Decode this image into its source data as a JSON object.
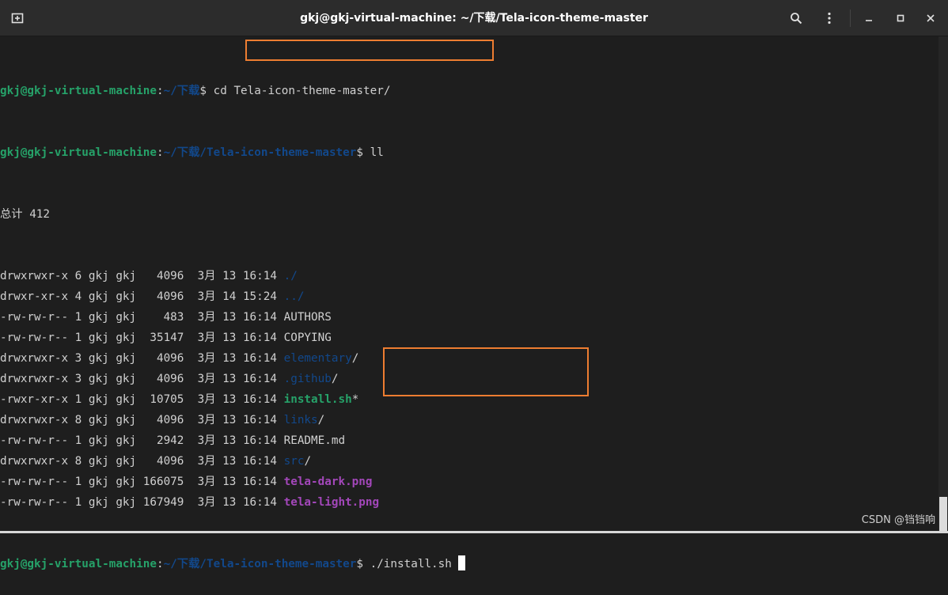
{
  "window": {
    "title": "gkj@gkj-virtual-machine: ~/下载/Tela-icon-theme-master",
    "icons": {
      "new_tab": "new-tab-icon",
      "search": "search-icon",
      "menu": "kebab-menu-icon",
      "minimize": "minimize-icon",
      "maximize": "maximize-icon",
      "close": "close-icon"
    }
  },
  "prompt": {
    "userhost": "gkj@gkj-virtual-machine",
    "colon": ":",
    "path1": "~/下载",
    "path2": "~/下载/Tela-icon-theme-master",
    "dollar": "$ "
  },
  "commands": {
    "cmd1_prefix": "cd ",
    "cmd1_arg": "Tela-icon-theme-master/",
    "cmd2": "ll",
    "cmd3": "./install.sh"
  },
  "total": "总计 412",
  "listing": [
    {
      "meta": "drwxrwxr-x 6 gkj gkj   4096  3月 13 16:14 ",
      "name": "./",
      "style": "bd"
    },
    {
      "meta": "drwxr-xr-x 4 gkj gkj   4096  3月 14 15:24 ",
      "name": "../",
      "style": "bd"
    },
    {
      "meta": "-rw-rw-r-- 1 gkj gkj    483  3月 13 16:14 ",
      "name": "AUTHORS",
      "style": "w"
    },
    {
      "meta": "-rw-rw-r-- 1 gkj gkj  35147  3月 13 16:14 ",
      "name": "COPYING",
      "style": "w"
    },
    {
      "meta": "drwxrwxr-x 3 gkj gkj   4096  3月 13 16:14 ",
      "name": "elementary",
      "suffix": "/",
      "style": "bd"
    },
    {
      "meta": "drwxrwxr-x 3 gkj gkj   4096  3月 13 16:14 ",
      "name": ".github",
      "suffix": "/",
      "style": "bd"
    },
    {
      "meta": "-rwxr-xr-x 1 gkj gkj  10705  3月 13 16:14 ",
      "name": "install.sh",
      "suffix": "*",
      "style": "gx"
    },
    {
      "meta": "drwxrwxr-x 8 gkj gkj   4096  3月 13 16:14 ",
      "name": "links",
      "suffix": "/",
      "style": "bd"
    },
    {
      "meta": "-rw-rw-r-- 1 gkj gkj   2942  3月 13 16:14 ",
      "name": "README.md",
      "style": "w"
    },
    {
      "meta": "drwxrwxr-x 8 gkj gkj   4096  3月 13 16:14 ",
      "name": "src",
      "suffix": "/",
      "style": "bd"
    },
    {
      "meta": "-rw-rw-r-- 1 gkj gkj 166075  3月 13 16:14 ",
      "name": "tela-dark.png",
      "style": "m"
    },
    {
      "meta": "-rw-rw-r-- 1 gkj gkj 167949  3月 13 16:14 ",
      "name": "tela-light.png",
      "style": "m"
    }
  ],
  "watermark": "CSDN @铛铛响",
  "colors": {
    "prompt_user": "#26a269",
    "prompt_path": "#12488b",
    "exec": "#26a269",
    "image": "#a347ba",
    "highlight": "#ed7d31",
    "background": "#1e1e1e"
  }
}
